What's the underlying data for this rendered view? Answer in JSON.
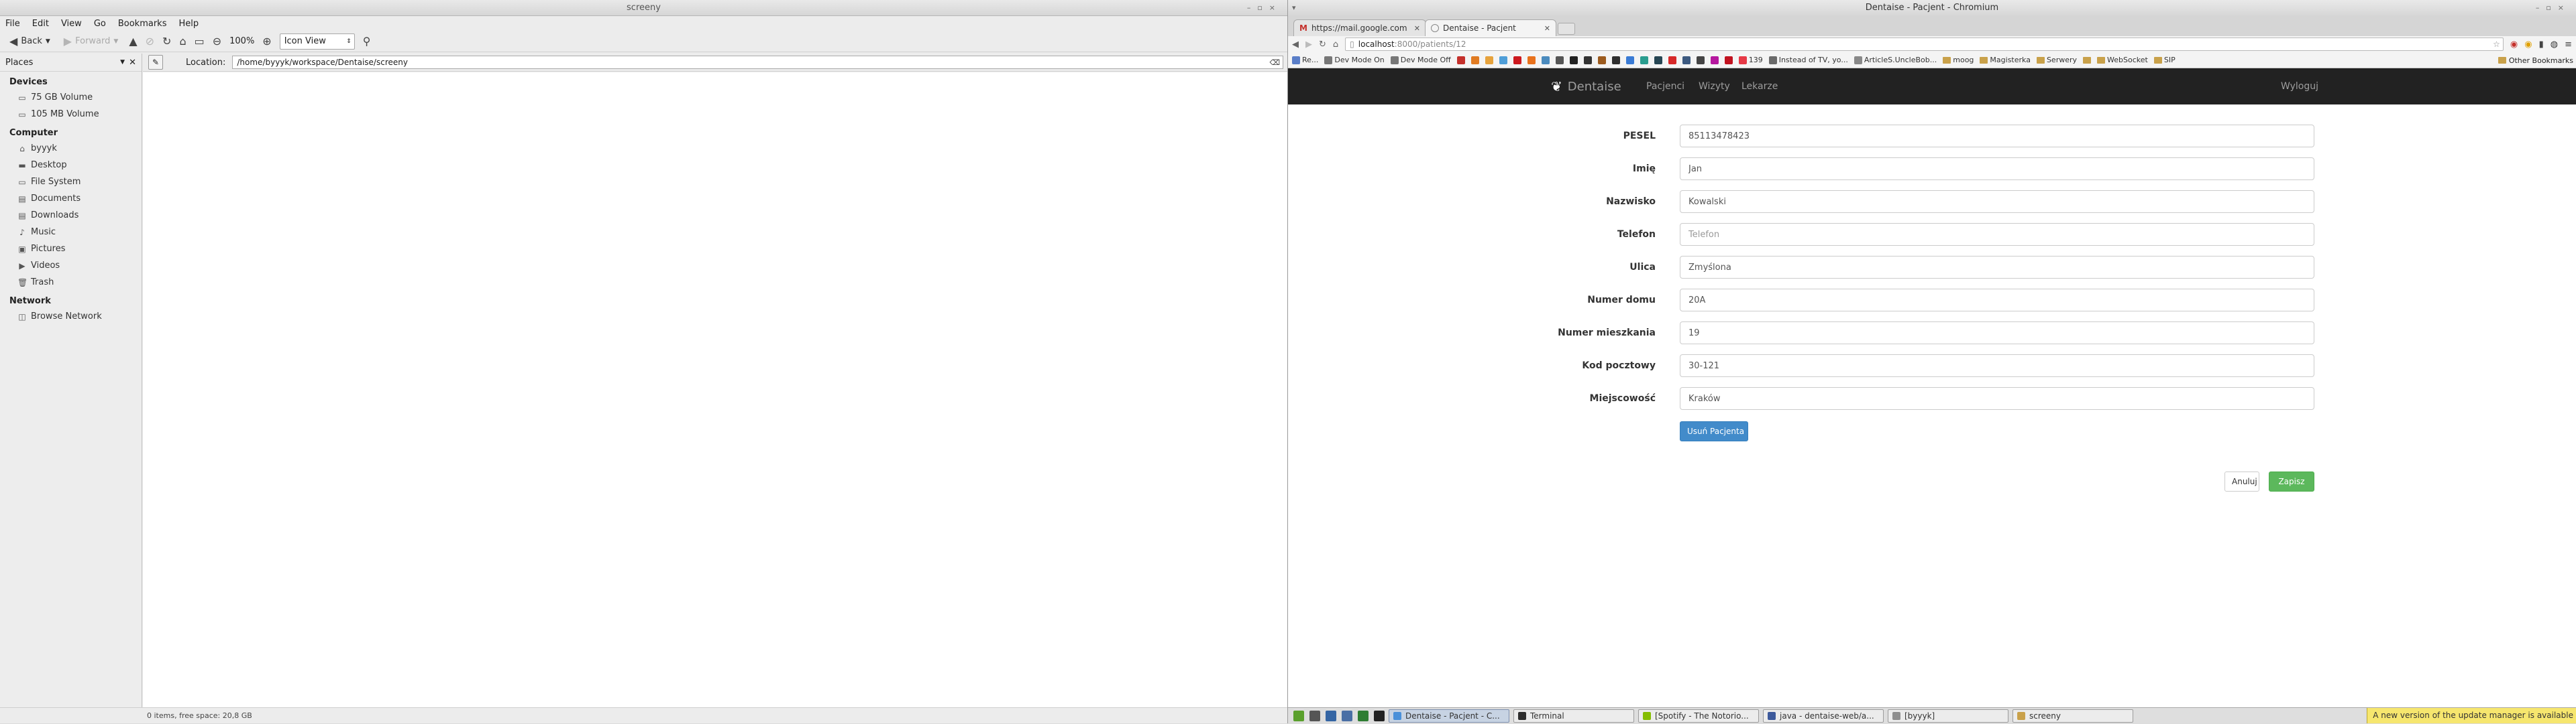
{
  "file_manager": {
    "title": "screeny",
    "menu": [
      "File",
      "Edit",
      "View",
      "Go",
      "Bookmarks",
      "Help"
    ],
    "toolbar": {
      "back": "Back",
      "forward": "Forward",
      "zoom": "100%",
      "view_mode": "Icon View"
    },
    "sidebar": {
      "header": "Places",
      "sections": [
        {
          "title": "Devices",
          "items": [
            {
              "label": "75 GB Volume",
              "icon": "drive-icon"
            },
            {
              "label": "105 MB Volume",
              "icon": "drive-icon"
            }
          ]
        },
        {
          "title": "Computer",
          "items": [
            {
              "label": "byyyk",
              "icon": "home-icon"
            },
            {
              "label": "Desktop",
              "icon": "desktop-icon"
            },
            {
              "label": "File System",
              "icon": "drive-icon"
            },
            {
              "label": "Documents",
              "icon": "folder-icon"
            },
            {
              "label": "Downloads",
              "icon": "folder-icon"
            },
            {
              "label": "Music",
              "icon": "music-icon"
            },
            {
              "label": "Pictures",
              "icon": "pictures-icon"
            },
            {
              "label": "Videos",
              "icon": "videos-icon"
            },
            {
              "label": "Trash",
              "icon": "trash-icon"
            }
          ]
        },
        {
          "title": "Network",
          "items": [
            {
              "label": "Browse Network",
              "icon": "network-icon"
            }
          ]
        }
      ]
    },
    "location_label": "Location:",
    "location_path": "/home/byyyk/workspace/Dentaise/screeny",
    "status": "0 items, free space: 20,8 GB"
  },
  "browser": {
    "window_title": "Dentaise - Pacjent - Chromium",
    "tabs": [
      {
        "title": "https://mail.google.com",
        "icon": "gmail-icon",
        "active": false
      },
      {
        "title": "Dentaise - Pacjent",
        "icon": "globe-icon",
        "active": true
      }
    ],
    "url_host": "localhost",
    "url_path": ":8000/patients/12",
    "bookmarks": [
      {
        "label": "Re...",
        "color": "#5a7ec8"
      },
      {
        "label": "Dev Mode On",
        "color": "#777777"
      },
      {
        "label": "Dev Mode Off",
        "color": "#777777"
      },
      {
        "label": "",
        "color": "#c4302b"
      },
      {
        "label": "",
        "color": "#e07b22"
      },
      {
        "label": "",
        "color": "#e6a23c"
      },
      {
        "label": "",
        "color": "#4f9ed8"
      },
      {
        "label": "",
        "color": "#cc181e"
      },
      {
        "label": "",
        "color": "#e8711c"
      },
      {
        "label": "",
        "color": "#4b8bbe"
      },
      {
        "label": "",
        "color": "#555555"
      },
      {
        "label": "",
        "color": "#222222"
      },
      {
        "label": "",
        "color": "#333333"
      },
      {
        "label": "",
        "color": "#9c5b1e"
      },
      {
        "label": "",
        "color": "#2e2e2e"
      },
      {
        "label": "",
        "color": "#3a7bd5"
      },
      {
        "label": "",
        "color": "#2a9d8f"
      },
      {
        "label": "",
        "color": "#264653"
      },
      {
        "label": "",
        "color": "#d62828"
      },
      {
        "label": "",
        "color": "#3d5a80"
      },
      {
        "label": "",
        "color": "#444444"
      },
      {
        "label": "",
        "color": "#b5179e"
      },
      {
        "label": "",
        "color": "#c1121f"
      },
      {
        "label": "139",
        "color": "#e63946"
      },
      {
        "label": "Instead of TV, yo...",
        "color": "#6a6a6a"
      },
      {
        "label": "ArticleS.UncleBob...",
        "color": "#888888"
      }
    ],
    "bookmark_folders": [
      "moog",
      "Magisterka",
      "Serwery",
      "",
      "WebSocket",
      "SIP"
    ],
    "other_bookmarks": "Other Bookmarks",
    "app": {
      "brand": "Dentaise",
      "nav": [
        "Pacjenci",
        "Wizyty",
        "Lekarze"
      ],
      "logout": "Wyloguj",
      "fields": [
        {
          "label": "PESEL",
          "value": "85113478423",
          "placeholder": ""
        },
        {
          "label": "Imię",
          "value": "Jan",
          "placeholder": ""
        },
        {
          "label": "Nazwisko",
          "value": "Kowalski",
          "placeholder": ""
        },
        {
          "label": "Telefon",
          "value": "",
          "placeholder": "Telefon"
        },
        {
          "label": "Ulica",
          "value": "Zmyślona",
          "placeholder": ""
        },
        {
          "label": "Numer domu",
          "value": "20A",
          "placeholder": ""
        },
        {
          "label": "Numer mieszkania",
          "value": "19",
          "placeholder": ""
        },
        {
          "label": "Kod pocztowy",
          "value": "30-121",
          "placeholder": ""
        },
        {
          "label": "Miejscowość",
          "value": "Kraków",
          "placeholder": ""
        }
      ],
      "delete_button": "Usuń Pacjenta",
      "cancel_button": "Anuluj",
      "save_button": "Zapisz",
      "colors": {
        "navbar": "#222222",
        "primary": "#428bca",
        "success": "#5cb85c"
      }
    }
  },
  "taskbar": {
    "launchers": [
      "#5aa02c",
      "#555555",
      "#3465a4",
      "#4a6fa5",
      "#2e7d32",
      "#222222"
    ],
    "tasks": [
      {
        "label": "Dentaise - Pacjent - C...",
        "color": "#4a90d9",
        "active": true
      },
      {
        "label": "Terminal",
        "color": "#2e2e2e",
        "active": false
      },
      {
        "label": "[Spotify - The Notorio...",
        "color": "#84bd00",
        "active": false
      },
      {
        "label": "java - dentaise-web/a...",
        "color": "#3d5a9c",
        "active": false
      },
      {
        "label": "[byyyk]",
        "color": "#8f8f8f",
        "active": false
      },
      {
        "label": "screeny",
        "color": "#c9a14a",
        "active": false
      }
    ],
    "notification": "A new version of the update manager is available"
  }
}
